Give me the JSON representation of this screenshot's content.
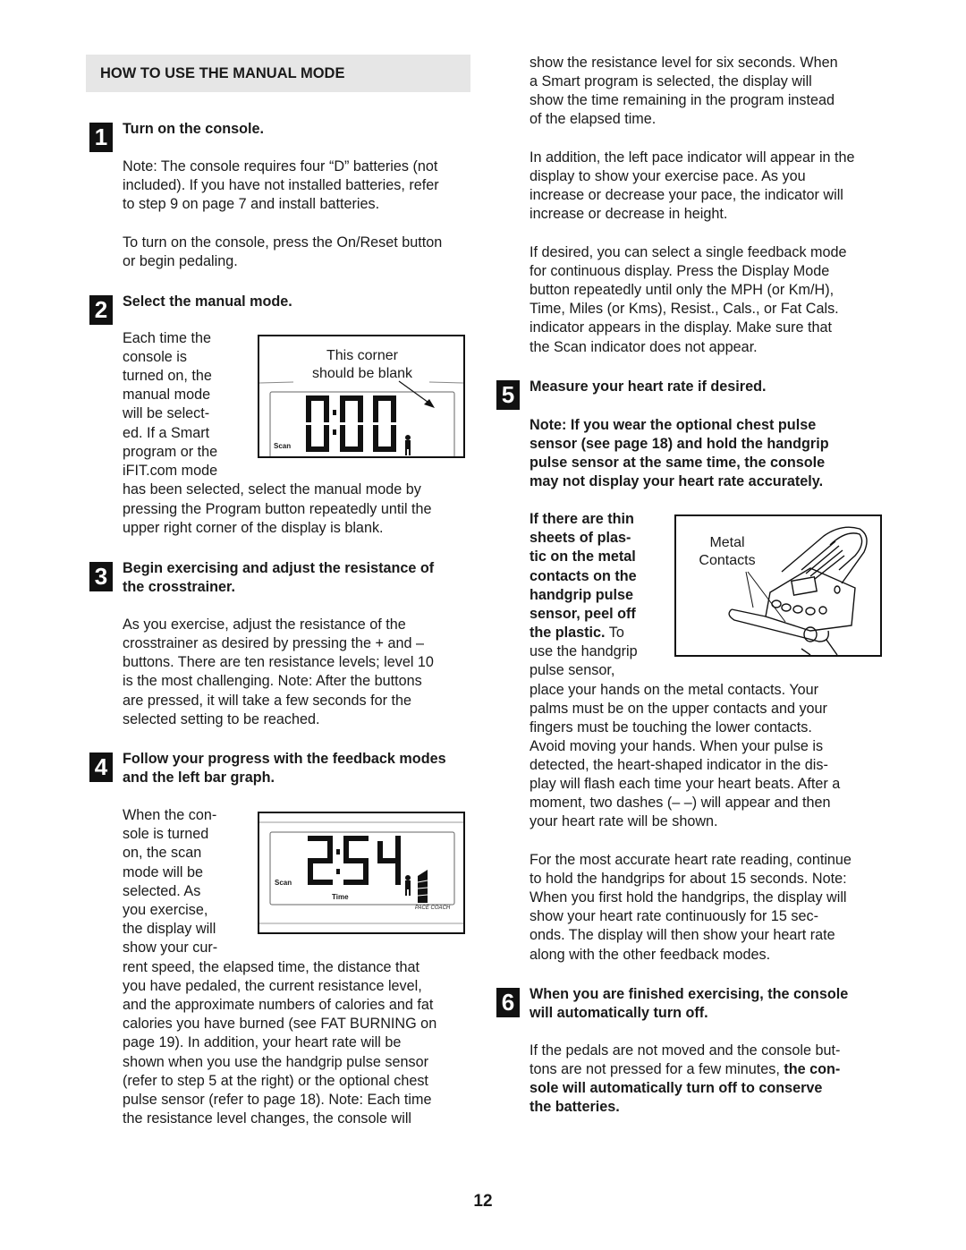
{
  "section": {
    "title": "HOW TO USE THE MANUAL MODE"
  },
  "steps": [
    {
      "number": "1",
      "title": "Turn on the console.",
      "paragraphs": [
        [
          "Note: The console requires four “D” batteries (not",
          "included). If you have not installed batteries, refer",
          "to step 9 on page 7 and install batteries."
        ],
        [
          "To turn on the console, press the On/Reset button",
          "or begin pedaling."
        ]
      ]
    },
    {
      "number": "2",
      "title": "Select the manual mode.",
      "wrap_lines": [
        "Each time the",
        "console is",
        "turned on, the",
        "manual mode",
        "will be select-",
        "ed. If a Smart",
        "program or the",
        "iFIT.com mode"
      ],
      "lines": [
        "has been selected, select the manual mode by",
        "pressing the Program button repeatedly until the",
        "upper right corner of the display is blank."
      ],
      "figure": {
        "caption_line1": "This corner",
        "caption_line2": "should be blank",
        "display_digits": "0:00",
        "scan_label": "Scan",
        "icons": [
          "person-icon",
          "arrow-icon"
        ]
      }
    },
    {
      "number": "3",
      "title_line1": "Begin exercising and adjust the resistance of",
      "title_line2": "the crosstrainer.",
      "lines": [
        "As you exercise, adjust the resistance of the",
        "crosstrainer as desired by pressing the + and –",
        "buttons. There are ten resistance levels; level 10",
        "is the most challenging. Note: After the buttons",
        "are pressed, it will take a few seconds for the",
        "selected setting to be reached."
      ]
    },
    {
      "number": "4",
      "title_line1": "Follow your progress with the feedback modes",
      "title_line2": "and the left bar graph.",
      "wrap_lines": [
        "When the con-",
        "sole is turned",
        "on, the scan",
        "mode will be",
        "selected. As",
        "you exercise,",
        "the display will",
        "show your cur-"
      ],
      "lines": [
        "rent speed, the elapsed time, the distance that",
        "you have pedaled, the current resistance level,",
        "and the approximate numbers of calories and fat",
        "calories you have burned (see FAT BURNING on",
        "page 19). In addition, your heart rate will be",
        "shown when you use the handgrip pulse sensor",
        "(refer to step 5 at the right) or the optional chest",
        "pulse sensor (refer to page 18). Note: Each time",
        "the resistance level changes, the console will"
      ],
      "figure": {
        "display_digits": "2:54",
        "scan_label": "Scan",
        "time_label": "Time",
        "pace_label": "PACE COACH",
        "icons": [
          "person-icon",
          "pace-bar-graph-icon"
        ]
      }
    },
    {
      "number": "5",
      "title": "Measure your heart rate if desired.",
      "note_lines": [
        "Note: If you wear the optional chest pulse",
        "sensor (see page 18) and hold the handgrip",
        "pulse sensor at the same time, the console",
        "may not display your heart rate accurately."
      ],
      "wrap_bold_lines": [
        "If there are thin",
        "sheets of plas-",
        "tic on the metal",
        "contacts on the",
        "handgrip pulse",
        "sensor, peel off",
        "the plastic."
      ],
      "wrap_tail": " To",
      "wrap_lines": [
        "use the handgrip",
        "pulse sensor,"
      ],
      "lines": [
        "place your hands on the metal contacts. Your",
        "palms must be on the upper contacts and your",
        "fingers must be touching the lower contacts.",
        "Avoid moving your hands. When your pulse is",
        "detected, the heart-shaped indicator in the dis-",
        "play will flash each time your heart beats. After a",
        "moment, two dashes (– –) will appear and then",
        "your heart rate will be shown."
      ],
      "lines2": [
        "For the most accurate heart rate reading, continue",
        "to hold the handgrips for about 15 seconds. Note:",
        "When you first hold the handgrips, the display will",
        "show your heart rate continuously for 15 sec-",
        "onds. The display will then show your heart rate",
        "along with the other feedback modes."
      ],
      "figure": {
        "caption_line1": "Metal",
        "caption_line2": "Contacts",
        "icons": [
          "console-handlebar-illustration"
        ]
      }
    },
    {
      "number": "6",
      "title_line1": "When you are finished exercising, the console",
      "title_line2": "will automatically turn off.",
      "line1": "If the pedals are not moved and the console but-",
      "line2_plain": "tons are not pressed for a few minutes, ",
      "line2_bold": "the con-",
      "bold_lines": [
        "sole will automatically turn off to conserve",
        "the batteries."
      ]
    }
  ],
  "continued_lines": [
    "show the resistance level for six seconds. When",
    "a Smart program is selected, the display will",
    "show the time remaining in the program instead",
    "of the elapsed time."
  ],
  "pace_paragraph": [
    "In addition, the left pace indicator will appear in the",
    "display to show your exercise pace. As you",
    "increase or decrease your pace, the indicator will",
    "increase or decrease in height."
  ],
  "single_mode_paragraph": [
    "If desired, you can select a single feedback mode",
    "for continuous display. Press the Display Mode",
    "button repeatedly until only the MPH (or Km/H),",
    "Time, Miles (or Kms), Resist., Cals., or Fat Cals.",
    "indicator appears in the display. Make sure that",
    "the Scan indicator does not appear."
  ],
  "page_number": "12"
}
